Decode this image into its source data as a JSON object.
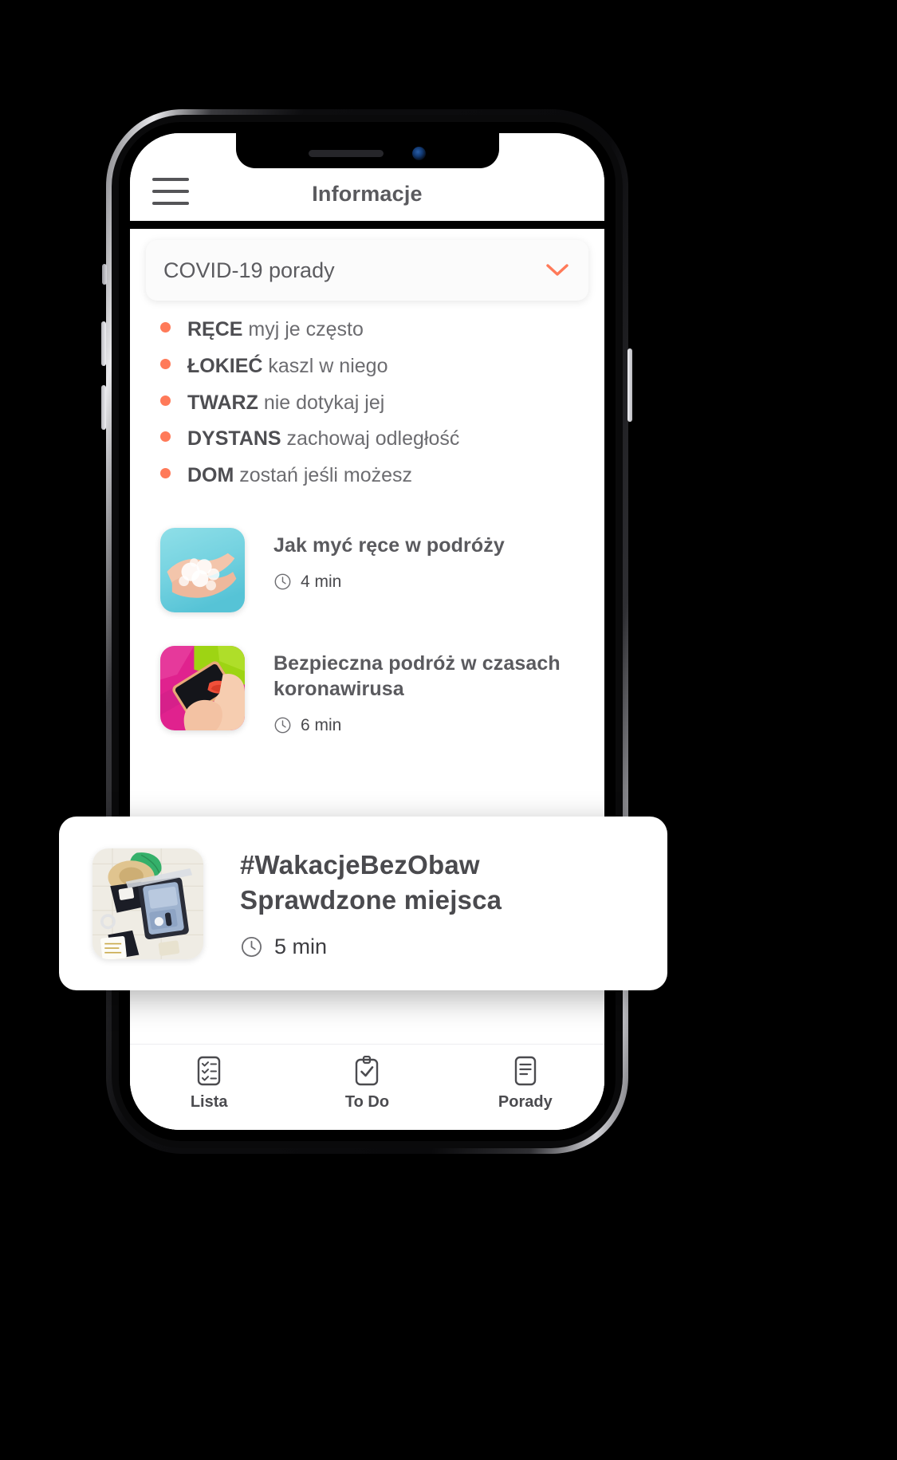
{
  "app": {
    "title": "Informacje",
    "menu_icon": "hamburger-menu-icon"
  },
  "accent_color": "#FF7A59",
  "filter": {
    "selected": "COVID-19 porady",
    "chevron_icon": "chevron-down-icon"
  },
  "tips": [
    {
      "keyword": "RĘCE",
      "rest": " myj je często"
    },
    {
      "keyword": "ŁOKIEĆ",
      "rest": " kaszl w niego"
    },
    {
      "keyword": "TWARZ",
      "rest": " nie dotykaj jej"
    },
    {
      "keyword": "DYSTANS",
      "rest": " zachowaj odległość"
    },
    {
      "keyword": "DOM",
      "rest": " zostań jeśli możesz"
    }
  ],
  "articles": [
    {
      "title": "Jak myć ręce w podróży",
      "duration": "4 min",
      "clock_icon": "clock-icon",
      "thumb_name": "washing-hands-thumbnail"
    },
    {
      "title": "Bezpieczna podróż w czasach koronawirusa",
      "duration": "6 min",
      "clock_icon": "clock-icon",
      "thumb_name": "cleaning-phone-thumbnail"
    }
  ],
  "highlight_card": {
    "title": "#WakacjeBezObaw Sprawdzone miejsca",
    "duration": "5 min",
    "clock_icon": "clock-icon",
    "thumb_name": "packed-suitcase-thumbnail"
  },
  "bottom_nav": [
    {
      "label": "Lista",
      "icon": "checklist-icon"
    },
    {
      "label": "To Do",
      "icon": "clipboard-check-icon"
    },
    {
      "label": "Porady",
      "icon": "document-lines-icon"
    }
  ]
}
